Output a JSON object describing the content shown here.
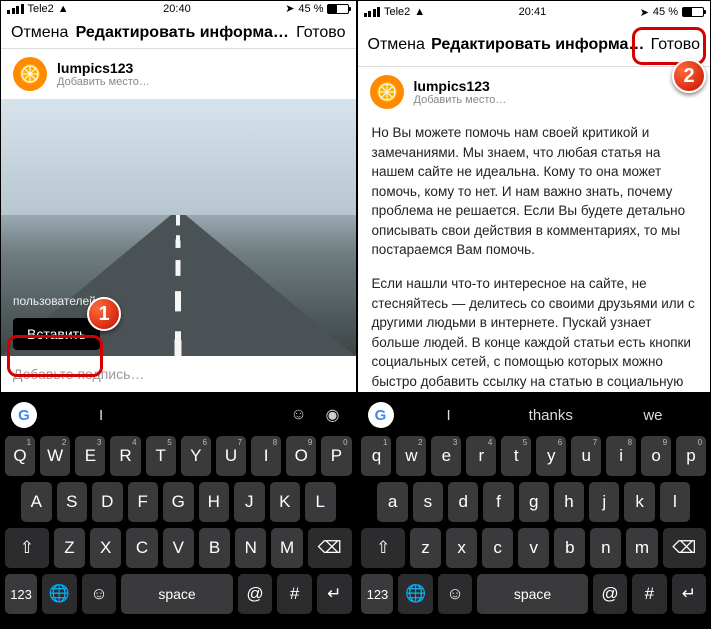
{
  "left": {
    "status": {
      "carrier": "Tele2",
      "time": "20:40",
      "battery_text": "45 %"
    },
    "nav": {
      "cancel": "Отмена",
      "title": "Редактировать информа…",
      "done": "Готово"
    },
    "user": {
      "name": "lumpics123",
      "place": "Добавить место…"
    },
    "photo": {
      "tag_users": "пользователей",
      "paste": "Вставить"
    },
    "caption_placeholder": "Добавьте подпись…",
    "badge": "1",
    "kbd": {
      "sugg": [
        "I",
        "",
        ""
      ],
      "row1": [
        "Q",
        "W",
        "E",
        "R",
        "T",
        "Y",
        "U",
        "I",
        "O",
        "P"
      ],
      "row2": [
        "A",
        "S",
        "D",
        "F",
        "G",
        "H",
        "J",
        "K",
        "L"
      ],
      "row3": [
        "Z",
        "X",
        "C",
        "V",
        "B",
        "N",
        "M"
      ],
      "num": "123",
      "space": "space",
      "hash": "#"
    }
  },
  "right": {
    "status": {
      "carrier": "Tele2",
      "time": "20:41",
      "battery_text": "45 %"
    },
    "nav": {
      "cancel": "Отмена",
      "title": "Редактировать информа…",
      "done": "Готово"
    },
    "user": {
      "name": "lumpics123",
      "place": "Добавить место…"
    },
    "body_p1": "Но Вы можете помочь нам своей критикой и замечаниями. Мы знаем, что любая статья на нашем сайте не идеальна. Кому то она может помочь, кому то нет. И нам важно знать, почему проблема не решается. Если Вы будете детально описывать свои действия в комментариях, то мы постараемся Вам помочь.",
    "body_p2": "Если нашли что-то интересное на сайте, не стесняйтесь — делитесь со своими друзьями или с другими людьми в интернете. Пускай узнает больше людей. В конце каждой статьи есть кнопки социальных сетей, с помощью которых можно быстро добавить ссылку на статью в социальную сеть.",
    "badge": "2",
    "kbd": {
      "sugg": [
        "I",
        "thanks",
        "we"
      ],
      "row1": [
        "q",
        "w",
        "e",
        "r",
        "t",
        "y",
        "u",
        "i",
        "o",
        "p"
      ],
      "row2": [
        "a",
        "s",
        "d",
        "f",
        "g",
        "h",
        "j",
        "k",
        "l"
      ],
      "row3": [
        "z",
        "x",
        "c",
        "v",
        "b",
        "n",
        "m"
      ],
      "num": "123",
      "space": "space",
      "hash": "#"
    }
  }
}
